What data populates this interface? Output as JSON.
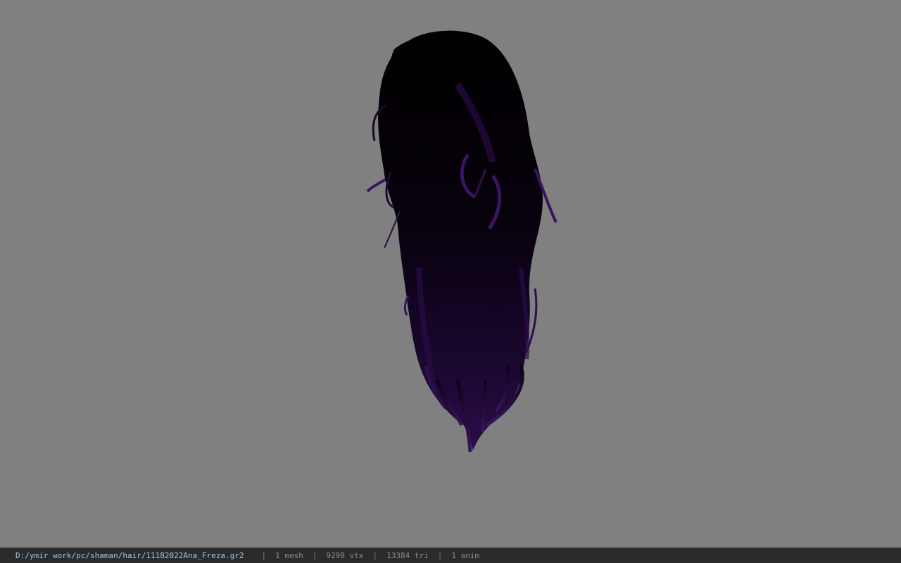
{
  "viewer": {
    "background_color": "#808080",
    "model": {
      "icon": "hair-mesh-icon",
      "base_color": "#050008",
      "highlight_color": "#3c1460"
    }
  },
  "statusbar": {
    "file_path": "D:/ymir work/pc/shaman/hair/11182022Ana_Freza.gr2",
    "separator": "|",
    "mesh_count": "1 mesh",
    "vertex_count": "9298 vtx",
    "triangle_count": "13384 tri",
    "anim_count": "1 anim"
  }
}
